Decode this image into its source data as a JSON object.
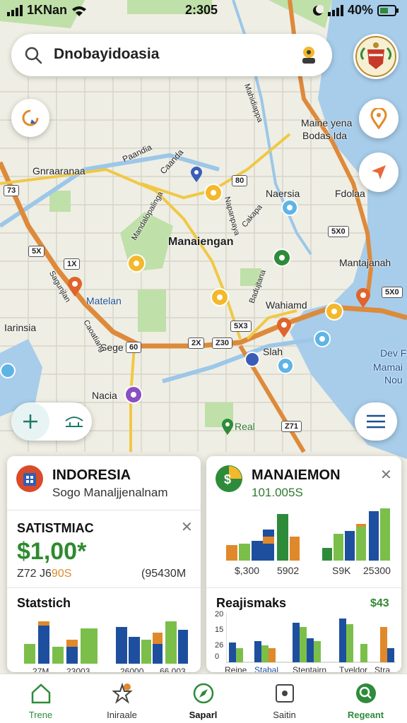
{
  "status": {
    "left": "1KNan",
    "time": "2:305",
    "battery": "40%"
  },
  "search": {
    "text": "Dnobayidoasia"
  },
  "map_labels": {
    "gnraaranaa": "Gnraaranaa",
    "paandia": "Paandia",
    "cadnia": "Caanda",
    "vertical1": "Mandalopalinga",
    "vertical2": "Mahidiappa",
    "vertical3": "Cakapa",
    "vertical4": "Badujtana",
    "mane_yena": "Maine yena",
    "bodas_ida": "Bodas Ida",
    "naersia": "Naersia",
    "fdolaa": "Fdolaa",
    "manaiengan": "Manaiengan",
    "mantajanah": "Mantajanah",
    "matelan": "Matelan",
    "wahaamd": "Wahiamd",
    "iarinsia": "Iarinsia",
    "sege": "Sege",
    "siah": "Slah",
    "dev_mamai": "Dev F",
    "mamai": "Mamai",
    "nou": "Nou",
    "nacia": "Nacia",
    "real": "Real",
    "vertical5": "Sagunjlan",
    "vertical6": "Caoatiang",
    "vertical7": "Napanpaya"
  },
  "badges": {
    "b1": "73",
    "b2": "80",
    "b3": "1X",
    "b4": "5X0",
    "b5": "5X3",
    "b6": "Z30",
    "b7": "5X0",
    "b8": "Z71",
    "b9": "5X",
    "b10": "2X",
    "b11": "60"
  },
  "card_left": {
    "title": "INDORESIA",
    "subtitle": "Sogo Manaljjenalnam",
    "section1_title": "SATISTMIAC",
    "big_value": "$1,00*",
    "small_value": "Z72 J6",
    "small_value2": "90S",
    "small_value_right": "(95430M",
    "section2_title": "Statstich",
    "ticks": [
      "27M",
      "23003",
      "26000",
      "66.003"
    ]
  },
  "card_right": {
    "title": "MANAIEMON",
    "subtitle": "101.005S",
    "ticks_top": [
      "$,300",
      "5902",
      "S9K",
      "25300"
    ],
    "section2_title": "Reajismaks",
    "section2_value": "$43",
    "yticks": [
      "20",
      "15",
      "26",
      "0",
      "0"
    ],
    "ticks_bottom": [
      "Reine",
      "Stabal",
      "Stentairn",
      "Tveldor",
      "Stra"
    ]
  },
  "nav": {
    "items": [
      {
        "label": "Trene"
      },
      {
        "label": "Iniraale"
      },
      {
        "label": "Saparl"
      },
      {
        "label": "Saitin"
      },
      {
        "label": "Regeant"
      }
    ]
  },
  "colors": {
    "accent": "#2f8a2f",
    "blue": "#1d4f9e",
    "orange": "#e0892b",
    "green": "#7bbf4a"
  }
}
